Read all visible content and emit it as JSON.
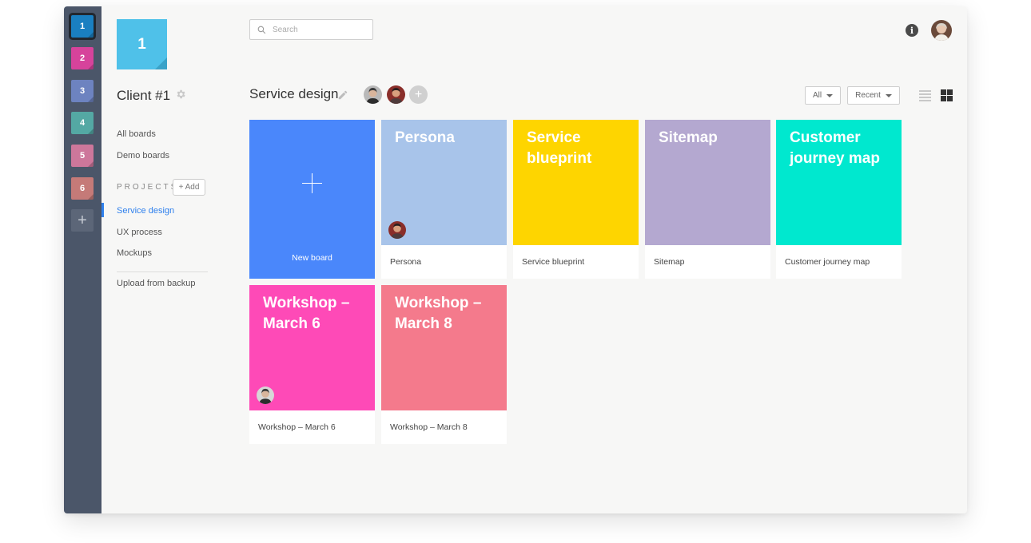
{
  "workspaces": [
    {
      "label": "1",
      "color": "#1a7fc1"
    },
    {
      "label": "2",
      "color": "#d6439b"
    },
    {
      "label": "3",
      "color": "#6d83c0"
    },
    {
      "label": "4",
      "color": "#54a8a4"
    },
    {
      "label": "5",
      "color": "#cd779b"
    },
    {
      "label": "6",
      "color": "#c57a78"
    }
  ],
  "workspace_add": "+",
  "logo": {
    "label": "1",
    "color": "#4fc1e9"
  },
  "client": {
    "title": "Client #1",
    "settings_icon": "gear-icon"
  },
  "sidebar": {
    "all_boards": "All boards",
    "demo_boards": "Demo boards",
    "projects_label": "PROJECTS",
    "add_label": "+ Add",
    "projects": [
      "Service design",
      "UX process",
      "Mockups"
    ],
    "selected_project": "Service design",
    "upload": "Upload from backup"
  },
  "search": {
    "placeholder": "Search"
  },
  "header": {
    "info_icon": "i"
  },
  "board": {
    "title": "Service design",
    "filter_all": "All",
    "filter_recent": "Recent",
    "add_member": "+"
  },
  "new_board": {
    "label": "New board"
  },
  "cards": [
    {
      "title": "Persona",
      "caption": "Persona",
      "color": "#a8c4ea",
      "avatar": true
    },
    {
      "title": "Service blueprint",
      "caption": "Service blueprint",
      "color": "#fed500",
      "avatar": false
    },
    {
      "title": "Sitemap",
      "caption": "Sitemap",
      "color": "#b4a8d0",
      "avatar": false
    },
    {
      "title": "Customer journey map",
      "caption": "Customer journey map",
      "color": "#00e8cf",
      "avatar": false
    },
    {
      "title": "Workshop – March 6",
      "caption": "Workshop – March 6",
      "color": "#fe4ab7",
      "avatar": true
    },
    {
      "title": "Workshop – March 8",
      "caption": "Workshop – March 8",
      "color": "#f47a8c",
      "avatar": false
    }
  ]
}
